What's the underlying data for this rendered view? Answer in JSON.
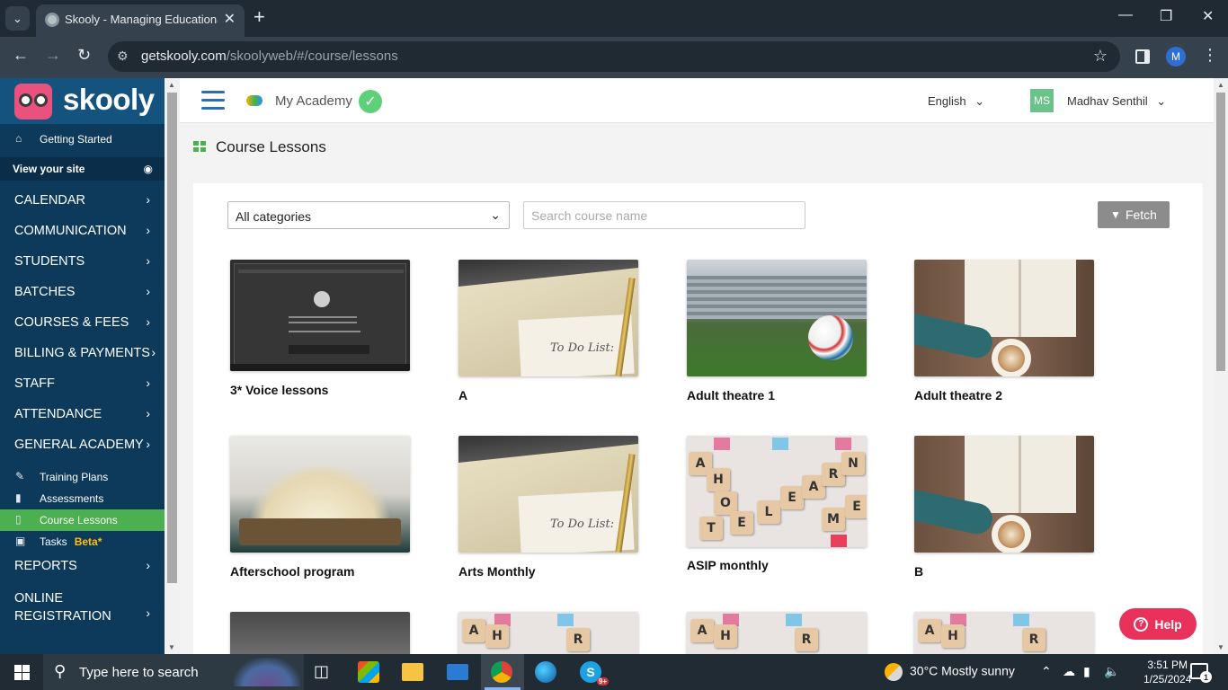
{
  "browser": {
    "tab_title": "Skooly - Managing Educational",
    "url_host": "getskooly.com",
    "url_path": "/skoolyweb/#/course/lessons",
    "profile_initial": "M"
  },
  "sidebar": {
    "logo_text": "skooly",
    "getting_started": "Getting Started",
    "view_site": "View your site",
    "menu": [
      {
        "label": "CALENDAR"
      },
      {
        "label": "COMMUNICATION"
      },
      {
        "label": "STUDENTS"
      },
      {
        "label": "BATCHES"
      },
      {
        "label": "COURSES & FEES"
      },
      {
        "label": "BILLING & PAYMENTS"
      },
      {
        "label": "STAFF"
      },
      {
        "label": "ATTENDANCE"
      },
      {
        "label": "GENERAL ACADEMY"
      }
    ],
    "sub": [
      {
        "label": "Training Plans"
      },
      {
        "label": "Assessments"
      },
      {
        "label": "Course Lessons"
      },
      {
        "label": "Tasks",
        "badge": "Beta*"
      }
    ],
    "reports": "REPORTS",
    "online_registration": "ONLINE REGISTRATION"
  },
  "topbar": {
    "academy_name": "My Academy",
    "language": "English",
    "user_initials": "MS",
    "user_name": "Madhav Senthil"
  },
  "page": {
    "title": "Course Lessons",
    "category_value": "All categories",
    "search_placeholder": "Search course name",
    "fetch_label": "Fetch"
  },
  "lessons": [
    {
      "title": "3* Voice lessons"
    },
    {
      "title": "A"
    },
    {
      "title": "Adult theatre 1"
    },
    {
      "title": "Adult theatre 2"
    },
    {
      "title": "Afterschool program"
    },
    {
      "title": "Arts Monthly"
    },
    {
      "title": "ASIP monthly"
    },
    {
      "title": "B"
    }
  ],
  "todo_note": "To Do List:",
  "help_label": "Help",
  "taskbar": {
    "search_text": "Type here to search",
    "weather": "30°C  Mostly sunny",
    "time": "3:51 PM",
    "date": "1/25/2024",
    "notification_count": "1",
    "skype_badge": "9+"
  },
  "colors": {
    "sidebar_bg": "#0d3a5a",
    "active_item": "#4caf50",
    "help_button": "#e8315b",
    "beta_badge": "#ffc107"
  }
}
